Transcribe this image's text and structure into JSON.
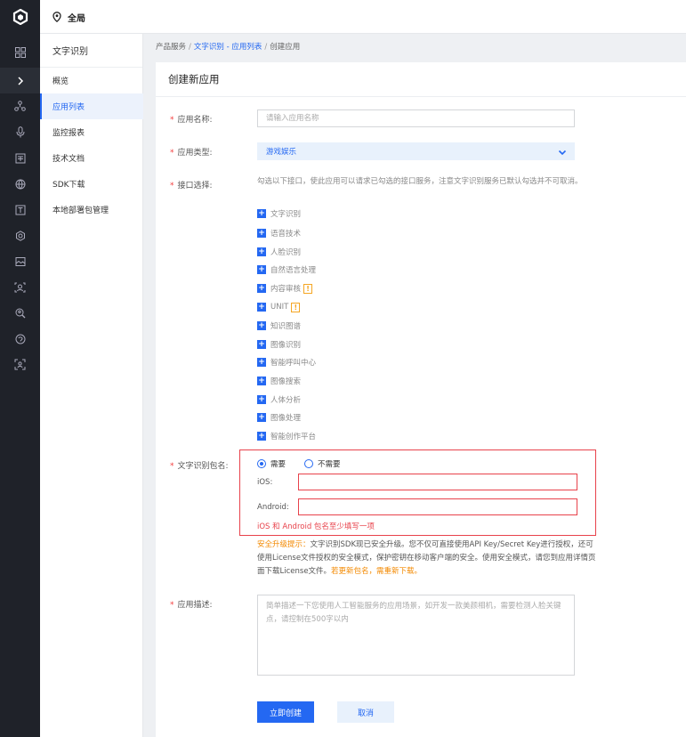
{
  "topbar": {
    "region_label": "全局"
  },
  "rail": {
    "icons": [
      "grid-icon",
      "chevron-right-icon",
      "nodes-icon",
      "microphone-icon",
      "document-icon",
      "globe-icon",
      "text-icon",
      "settings-gear-icon",
      "image-icon",
      "face-scan-icon",
      "search-face-icon",
      "speech-icon",
      "scan-icon"
    ]
  },
  "subnav": {
    "title": "文字识别",
    "items": [
      {
        "label": "概览"
      },
      {
        "label": "应用列表"
      },
      {
        "label": "监控报表"
      },
      {
        "label": "技术文档"
      },
      {
        "label": "SDK下载"
      },
      {
        "label": "本地部署包管理"
      }
    ],
    "active_index": 1
  },
  "breadcrumb": {
    "root": "产品服务",
    "link": "文字识别 - 应用列表",
    "current": "创建应用",
    "sep": "/"
  },
  "form": {
    "title": "创建新应用",
    "app_name": {
      "label": "应用名称:",
      "placeholder": "请输入应用名称"
    },
    "app_type": {
      "label": "应用类型:",
      "value": "游戏娱乐"
    },
    "api": {
      "label": "接口选择:",
      "hint": "勾选以下接口，使此应用可以请求已勾选的接口服务，注意文字识别服务已默认勾选并不可取消。",
      "items": [
        {
          "label": "文字识别",
          "warn": false
        },
        {
          "label": "语音技术",
          "warn": false
        },
        {
          "label": "人脸识别",
          "warn": false
        },
        {
          "label": "自然语言处理",
          "warn": false
        },
        {
          "label": "内容审核",
          "warn": true
        },
        {
          "label": "UNIT",
          "warn": true
        },
        {
          "label": "知识图谱",
          "warn": false
        },
        {
          "label": "图像识别",
          "warn": false
        },
        {
          "label": "智能呼叫中心",
          "warn": false
        },
        {
          "label": "图像搜索",
          "warn": false
        },
        {
          "label": "人体分析",
          "warn": false
        },
        {
          "label": "图像处理",
          "warn": false
        },
        {
          "label": "智能创作平台",
          "warn": false
        }
      ],
      "warn_glyph": "!",
      "plus_glyph": "+"
    },
    "package": {
      "label": "文字识别包名:",
      "option_need": "需要",
      "option_no": "不需要",
      "ios_label": "iOS:",
      "android_label": "Android:",
      "error": "iOS 和 Android 包名至少填写一项"
    },
    "upgrade": {
      "prefix": "安全升级提示：",
      "body": "文字识别SDK现已安全升级。您不仅可直接使用API Key/Secret Key进行授权，还可使用License文件授权的安全模式，保护密钥在移动客户端的安全。使用安全模式，请您到应用详情页面下载License文件。",
      "suffix": "若更新包名，需重新下载。"
    },
    "description": {
      "label": "应用描述:",
      "placeholder": "简单描述一下您使用人工智能服务的应用场景，如开发一款美颜相机，需要检测人脸关键点，请控制在500字以内"
    },
    "submit_label": "立即创建",
    "cancel_label": "取消",
    "required_mark": "*"
  },
  "colors": {
    "brand": "#2468f2",
    "error": "#e8424b",
    "warn": "#f38900",
    "rail_bg": "#1f2229"
  }
}
